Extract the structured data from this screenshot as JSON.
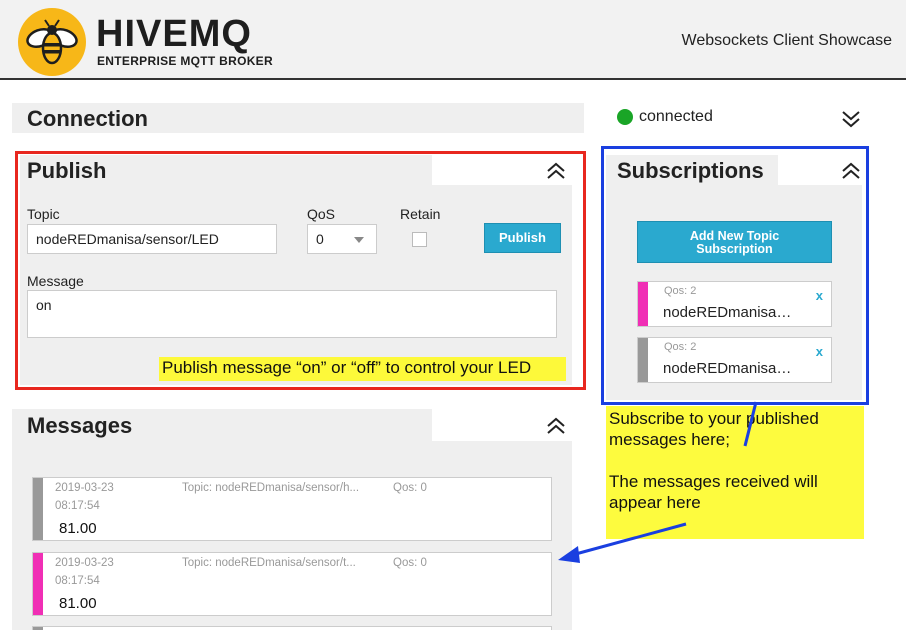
{
  "header": {
    "logo_text": "HIVEMQ",
    "logo_subtitle": "ENTERPRISE MQTT BROKER",
    "showcase_title": "Websockets Client Showcase"
  },
  "connection": {
    "title": "Connection",
    "status": "connected",
    "status_color": "#1aa527"
  },
  "publish": {
    "title": "Publish",
    "topic_label": "Topic",
    "topic_value": "nodeREDmanisa/sensor/LED",
    "qos_label": "QoS",
    "qos_value": "0",
    "retain_label": "Retain",
    "retain_checked": false,
    "publish_button": "Publish",
    "message_label": "Message",
    "message_value": "on",
    "annotation": "Publish message “on” or “off” to control your LED"
  },
  "subscriptions": {
    "title": "Subscriptions",
    "add_button_line1": "Add New Topic",
    "add_button_line2": "Subscription",
    "items": [
      {
        "qos": "Qos: 2",
        "topic": "nodeREDmanisa…",
        "color": "#f02fb5",
        "remove": "x"
      },
      {
        "qos": "Qos: 2",
        "topic": "nodeREDmanisa…",
        "color": "#999999",
        "remove": "x"
      }
    ]
  },
  "subscribe_note": {
    "line1": "Subscribe to your published messages here;",
    "line2": "The messages received will appear here"
  },
  "messages": {
    "title": "Messages",
    "items": [
      {
        "date": "2019-03-23",
        "time": "08:17:54",
        "topic": "Topic: nodeREDmanisa/sensor/h...",
        "qos": "Qos: 0",
        "value": "81.00",
        "color": "#999999"
      },
      {
        "date": "2019-03-23",
        "time": "08:17:54",
        "topic": "Topic: nodeREDmanisa/sensor/t...",
        "qos": "Qos: 0",
        "value": "81.00",
        "color": "#f02fb5"
      }
    ]
  },
  "colors": {
    "publish_highlight": "#e8271f",
    "subscriptions_highlight": "#1a3fe0",
    "button": "#2aa9cf",
    "note": "#fdf93a"
  }
}
